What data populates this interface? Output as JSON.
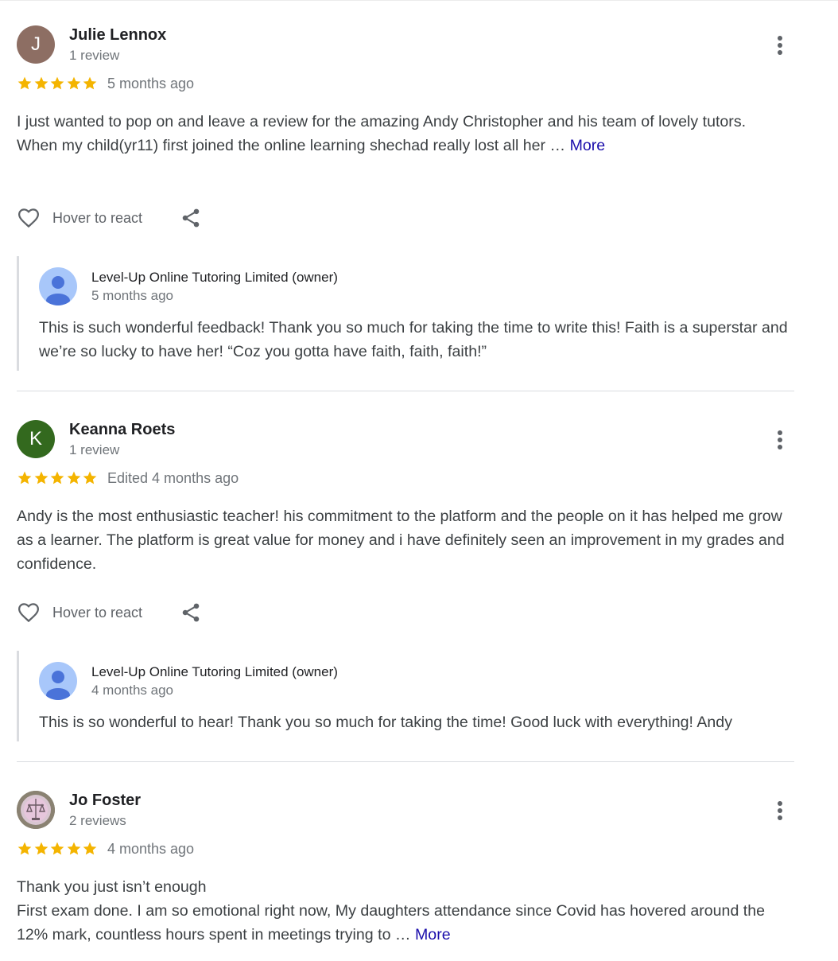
{
  "colors": {
    "star": "#f4b400",
    "link": "#1a0dab",
    "divider": "#dadce0"
  },
  "reviews": [
    {
      "avatar_letter": "J",
      "avatar_color": "#8d6e63",
      "name": "Julie Lennox",
      "review_count": "1 review",
      "rating": 5,
      "time": "5 months ago",
      "lines": [
        "I just wanted to pop on and leave a review for the amazing Andy Christopher and his team of lovely tutors.",
        "When my child(yr11) first joined the online learning shechad really lost all her …"
      ],
      "more_label": "More",
      "react_label": "Hover to react",
      "reply": {
        "owner_name": "Level-Up Online Tutoring Limited (owner)",
        "time": "5 months ago",
        "text": "This is such wonderful feedback! Thank you so much for taking the time to write this! Faith is a superstar and we’re so lucky to have her! “Coz you gotta have faith, faith, faith!”"
      }
    },
    {
      "avatar_letter": "K",
      "avatar_color": "#33691e",
      "name": "Keanna Roets",
      "review_count": "1 review",
      "rating": 5,
      "time": "Edited 4 months ago",
      "lines": [
        "Andy is the most enthusiastic teacher! his commitment to the platform and the people on it has helped me grow as a learner. The platform is great value for money and i have definitely seen an improvement in my grades and confidence."
      ],
      "react_label": "Hover to react",
      "reply": {
        "owner_name": "Level-Up Online Tutoring Limited (owner)",
        "time": "4 months ago",
        "text": "This is so wonderful to hear! Thank you so much for taking the time! Good luck with everything! Andy"
      }
    },
    {
      "name": "Jo Foster",
      "review_count": "2 reviews",
      "rating": 5,
      "time": "4 months ago",
      "lines": [
        "Thank you just isn’t enough",
        "First exam done. I am so emotional right now, My daughters attendance since Covid has hovered around the 12% mark, countless hours spent in meetings trying to …"
      ],
      "more_label": "More"
    }
  ]
}
